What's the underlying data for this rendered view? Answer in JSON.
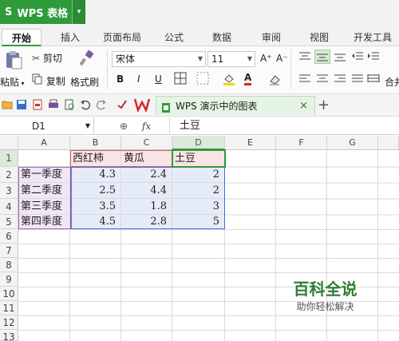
{
  "app": {
    "logo_glyph": "S",
    "title": "WPS 表格",
    "menu_arrow": "▾"
  },
  "tabs": [
    {
      "label": "开始",
      "active": true
    },
    {
      "label": "插入"
    },
    {
      "label": "页面布局"
    },
    {
      "label": "公式"
    },
    {
      "label": "数据"
    },
    {
      "label": "审阅"
    },
    {
      "label": "视图"
    },
    {
      "label": "开发工具"
    }
  ],
  "ribbon": {
    "paste_label": "粘贴",
    "cut_label": "剪切",
    "copy_label": "复制",
    "format_painter_label": "格式刷",
    "font_name": "宋体",
    "font_size": "11",
    "grow_font": "A⁺",
    "shrink_font": "A⁻",
    "bold": "B",
    "italic": "I",
    "underline": "U",
    "font_color_letter": "A",
    "merge_partial": "合并"
  },
  "document_tab": {
    "label": "WPS 演示中的图表",
    "close": "×",
    "new": "+"
  },
  "formula_bar": {
    "cell_ref": "D1",
    "fx": "fx",
    "value": "土豆"
  },
  "columns": [
    "A",
    "B",
    "C",
    "D",
    "E",
    "F",
    "G"
  ],
  "rows": [
    "1",
    "2",
    "3",
    "4",
    "5",
    "6",
    "7",
    "8",
    "9",
    "10",
    "11",
    "12",
    "13"
  ],
  "table": {
    "headers": [
      "",
      "西红柿",
      "黄瓜",
      "土豆"
    ],
    "data": [
      [
        "第一季度",
        "4.3",
        "2.4",
        "2"
      ],
      [
        "第二季度",
        "2.5",
        "4.4",
        "2"
      ],
      [
        "第三季度",
        "3.5",
        "1.8",
        "3"
      ],
      [
        "第四季度",
        "4.5",
        "2.8",
        "5"
      ]
    ]
  },
  "watermark": {
    "title": "百科全说",
    "subtitle": "助你轻松解决"
  },
  "colors": {
    "brand": "#2f9a3a",
    "range_purple": "#a16ab5",
    "range_red": "#d06060",
    "range_blue": "#4c6bd6"
  }
}
